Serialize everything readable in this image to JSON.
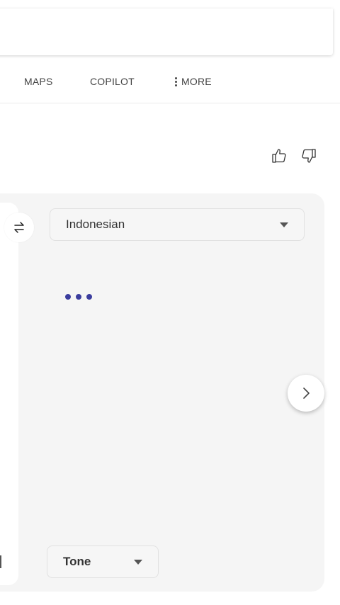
{
  "nav": {
    "tabs": [
      {
        "label": "MAPS"
      },
      {
        "label": "COPILOT"
      },
      {
        "label": "MORE"
      }
    ]
  },
  "feedback": {
    "like_icon": "thumbs-up-icon",
    "dislike_icon": "thumbs-down-icon"
  },
  "translator": {
    "target_language": "Indonesian",
    "tone_label": "Tone",
    "swap_icon": "swap-arrows-icon",
    "next_icon": "chevron-right-icon",
    "loading_color": "#3b3d9e"
  }
}
